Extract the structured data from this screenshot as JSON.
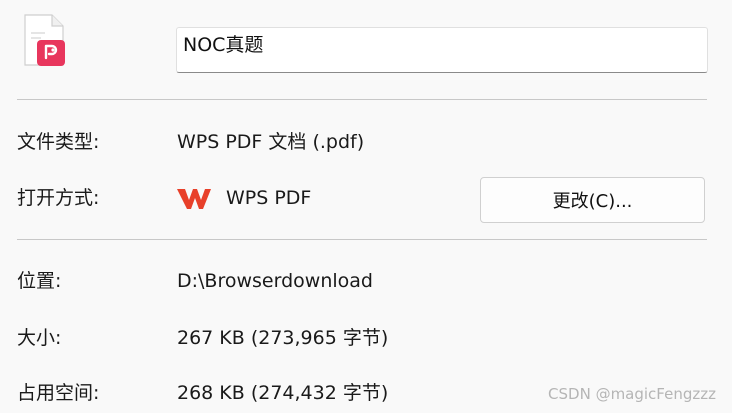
{
  "file": {
    "icon": "pdf-file-icon",
    "name_value": "NOC真题"
  },
  "properties": {
    "type_label": "文件类型:",
    "type_value": "WPS PDF 文档 (.pdf)",
    "open_with_label": "打开方式:",
    "open_with_app_icon": "wps-logo-icon",
    "open_with_value": "WPS PDF",
    "change_button_label": "更改(C)...",
    "location_label": "位置:",
    "location_value": "D:\\Browserdownload",
    "size_label": "大小:",
    "size_value": "267 KB (273,965 字节)",
    "disk_size_label": "占用空间:",
    "disk_size_value": "268 KB (274,432 字节)"
  },
  "watermark": "CSDN @magicFengzzz",
  "colors": {
    "pdf_accent": "#e8365d",
    "wps_red": "#e8402a"
  }
}
